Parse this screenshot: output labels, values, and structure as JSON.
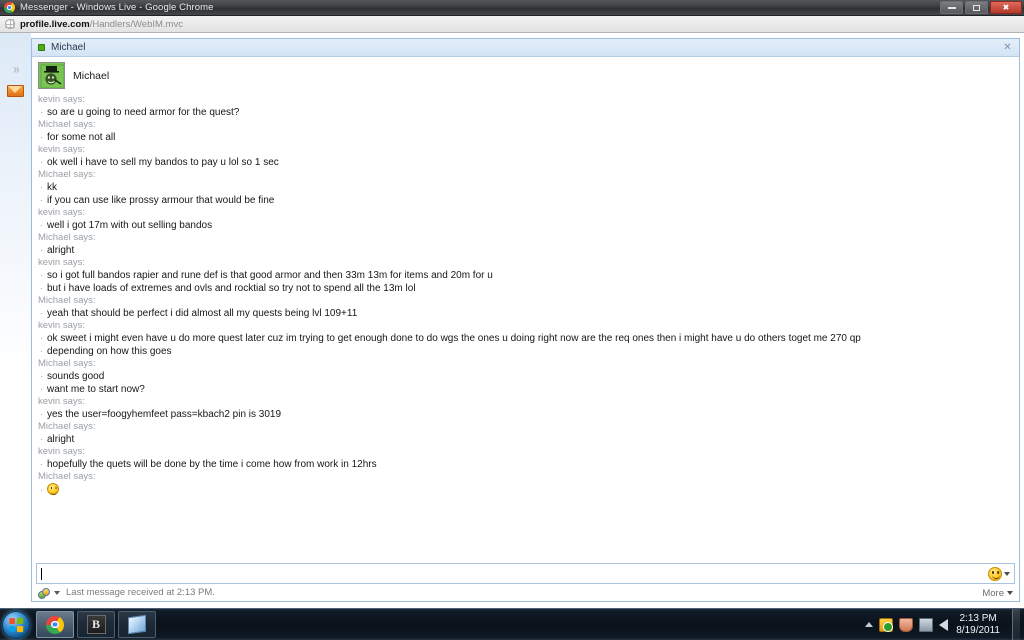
{
  "browser": {
    "window_title": "Messenger - Windows Live - Google Chrome",
    "url_host": "profile.live.com",
    "url_path": "/Handlers/WebIM.mvc",
    "minimize_label": "Minimize",
    "maximize_label": "Restore",
    "close_label": "Close"
  },
  "rail": {
    "expand_label": "»",
    "mail_label": "Mail"
  },
  "conversation": {
    "header_title": "Michael",
    "close_label": "✕",
    "contact_name": "Michael",
    "status": "online",
    "messages": [
      {
        "sender": "kevin says:",
        "lines": [
          "so are u going to need armor for the quest?"
        ]
      },
      {
        "sender": "Michael says:",
        "lines": [
          "for some not all"
        ]
      },
      {
        "sender": "kevin says:",
        "lines": [
          "ok well i have to sell my bandos to pay u lol so 1 sec"
        ]
      },
      {
        "sender": "Michael says:",
        "lines": [
          "kk",
          "if you can use like prossy armour that would be fine"
        ]
      },
      {
        "sender": "kevin says:",
        "lines": [
          "well i got 17m with out selling bandos"
        ]
      },
      {
        "sender": "Michael says:",
        "lines": [
          "alright"
        ]
      },
      {
        "sender": "kevin says:",
        "lines": [
          "so i got full bandos rapier and rune def is that good armor and then 33m 13m for items and 20m for u",
          "but i have loads of extremes and ovls and rocktial so try not to spend all the 13m lol"
        ]
      },
      {
        "sender": "Michael says:",
        "lines": [
          "yeah that should be perfect i did almost all my quests being lvl 109+11"
        ]
      },
      {
        "sender": "kevin says:",
        "lines": [
          "ok sweet i might even have u do more quest later cuz im trying to get enough done to do wgs the ones u doing right now are the req ones then i might have u do others toget me 270 qp",
          "depending on how this goes"
        ]
      },
      {
        "sender": "Michael says:",
        "lines": [
          "sounds good",
          "want me to start now?"
        ]
      },
      {
        "sender": "kevin says:",
        "lines": [
          "yes the user=foogyhemfeet pass=kbach2 pin is 3019"
        ]
      },
      {
        "sender": "Michael says:",
        "lines": [
          "alright"
        ]
      },
      {
        "sender": "kevin says:",
        "lines": [
          "hopefully the quets will be done by the time i come how from work in 12hrs"
        ]
      },
      {
        "sender": "Michael says:",
        "lines": [
          "__EMOJI_SMILE__"
        ]
      }
    ],
    "composer": {
      "value": "",
      "placeholder": "",
      "emoji_button_label": "Emoticons"
    },
    "status_bar": {
      "text": "Last message received at 2:13 PM.",
      "more_label": "More"
    }
  },
  "taskbar": {
    "start_label": "Start",
    "items": [
      {
        "name": "chrome",
        "label": "Google Chrome"
      },
      {
        "name": "app-b",
        "label": "B"
      },
      {
        "name": "notepad",
        "label": "Notepad"
      }
    ],
    "tray": {
      "show_hidden_label": "Show hidden icons",
      "security_label": "Action Center",
      "flag_label": "Flag",
      "network_label": "Network",
      "volume_label": "Volume"
    },
    "clock_time": "2:13 PM",
    "clock_date": "8/19/2011"
  }
}
